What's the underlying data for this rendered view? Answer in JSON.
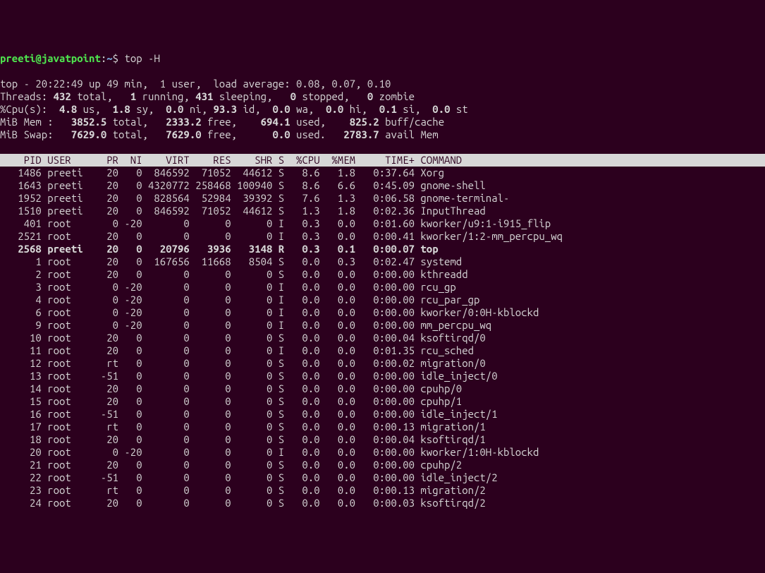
{
  "prompt": {
    "user": "preeti@javatpoint",
    "path": "~",
    "command": "top -H"
  },
  "summary": {
    "line1": "top - 20:22:49 up 49 min,  1 user,  load average: 0.08, 0.07, 0.10",
    "threads": {
      "total": "432",
      "running": "1",
      "sleeping": "431",
      "stopped": "0",
      "zombie": "0"
    },
    "cpu": {
      "us": "4.8",
      "sy": "1.8",
      "ni": "0.0",
      "id": "93.3",
      "wa": "0.0",
      "hi": "0.0",
      "si": "0.1",
      "st": "0.0"
    },
    "mem": {
      "total": "3852.5",
      "free": "2333.2",
      "used": "694.1",
      "buff": "825.2"
    },
    "swap": {
      "total": "7629.0",
      "free": "7629.0",
      "used": "0.0",
      "avail": "2783.7"
    }
  },
  "headers": "    PID USER      PR  NI    VIRT    RES    SHR S  %CPU  %MEM     TIME+ COMMAND",
  "processes": [
    {
      "pid": "1486",
      "user": "preeti",
      "pr": "20",
      "ni": "0",
      "virt": "846592",
      "res": "71052",
      "shr": "44612",
      "s": "S",
      "cpu": "8.6",
      "mem": "1.8",
      "time": "0:37.64",
      "cmd": "Xorg",
      "bold": false
    },
    {
      "pid": "1643",
      "user": "preeti",
      "pr": "20",
      "ni": "0",
      "virt": "4320772",
      "res": "258468",
      "shr": "100940",
      "s": "S",
      "cpu": "8.6",
      "mem": "6.6",
      "time": "0:45.09",
      "cmd": "gnome-shell",
      "bold": false
    },
    {
      "pid": "1952",
      "user": "preeti",
      "pr": "20",
      "ni": "0",
      "virt": "828564",
      "res": "52984",
      "shr": "39392",
      "s": "S",
      "cpu": "7.6",
      "mem": "1.3",
      "time": "0:06.58",
      "cmd": "gnome-terminal-",
      "bold": false
    },
    {
      "pid": "1510",
      "user": "preeti",
      "pr": "20",
      "ni": "0",
      "virt": "846592",
      "res": "71052",
      "shr": "44612",
      "s": "S",
      "cpu": "1.3",
      "mem": "1.8",
      "time": "0:02.36",
      "cmd": "InputThread",
      "bold": false
    },
    {
      "pid": "401",
      "user": "root",
      "pr": "0",
      "ni": "-20",
      "virt": "0",
      "res": "0",
      "shr": "0",
      "s": "I",
      "cpu": "0.3",
      "mem": "0.0",
      "time": "0:01.60",
      "cmd": "kworker/u9:1-i915_flip",
      "bold": false
    },
    {
      "pid": "2521",
      "user": "root",
      "pr": "20",
      "ni": "0",
      "virt": "0",
      "res": "0",
      "shr": "0",
      "s": "I",
      "cpu": "0.3",
      "mem": "0.0",
      "time": "0:00.41",
      "cmd": "kworker/1:2-mm_percpu_wq",
      "bold": false
    },
    {
      "pid": "2568",
      "user": "preeti",
      "pr": "20",
      "ni": "0",
      "virt": "20796",
      "res": "3936",
      "shr": "3148",
      "s": "R",
      "cpu": "0.3",
      "mem": "0.1",
      "time": "0:00.07",
      "cmd": "top",
      "bold": true
    },
    {
      "pid": "1",
      "user": "root",
      "pr": "20",
      "ni": "0",
      "virt": "167656",
      "res": "11668",
      "shr": "8504",
      "s": "S",
      "cpu": "0.0",
      "mem": "0.3",
      "time": "0:02.47",
      "cmd": "systemd",
      "bold": false
    },
    {
      "pid": "2",
      "user": "root",
      "pr": "20",
      "ni": "0",
      "virt": "0",
      "res": "0",
      "shr": "0",
      "s": "S",
      "cpu": "0.0",
      "mem": "0.0",
      "time": "0:00.00",
      "cmd": "kthreadd",
      "bold": false
    },
    {
      "pid": "3",
      "user": "root",
      "pr": "0",
      "ni": "-20",
      "virt": "0",
      "res": "0",
      "shr": "0",
      "s": "I",
      "cpu": "0.0",
      "mem": "0.0",
      "time": "0:00.00",
      "cmd": "rcu_gp",
      "bold": false
    },
    {
      "pid": "4",
      "user": "root",
      "pr": "0",
      "ni": "-20",
      "virt": "0",
      "res": "0",
      "shr": "0",
      "s": "I",
      "cpu": "0.0",
      "mem": "0.0",
      "time": "0:00.00",
      "cmd": "rcu_par_gp",
      "bold": false
    },
    {
      "pid": "6",
      "user": "root",
      "pr": "0",
      "ni": "-20",
      "virt": "0",
      "res": "0",
      "shr": "0",
      "s": "I",
      "cpu": "0.0",
      "mem": "0.0",
      "time": "0:00.00",
      "cmd": "kworker/0:0H-kblockd",
      "bold": false
    },
    {
      "pid": "9",
      "user": "root",
      "pr": "0",
      "ni": "-20",
      "virt": "0",
      "res": "0",
      "shr": "0",
      "s": "I",
      "cpu": "0.0",
      "mem": "0.0",
      "time": "0:00.00",
      "cmd": "mm_percpu_wq",
      "bold": false
    },
    {
      "pid": "10",
      "user": "root",
      "pr": "20",
      "ni": "0",
      "virt": "0",
      "res": "0",
      "shr": "0",
      "s": "S",
      "cpu": "0.0",
      "mem": "0.0",
      "time": "0:00.04",
      "cmd": "ksoftirqd/0",
      "bold": false
    },
    {
      "pid": "11",
      "user": "root",
      "pr": "20",
      "ni": "0",
      "virt": "0",
      "res": "0",
      "shr": "0",
      "s": "I",
      "cpu": "0.0",
      "mem": "0.0",
      "time": "0:01.35",
      "cmd": "rcu_sched",
      "bold": false
    },
    {
      "pid": "12",
      "user": "root",
      "pr": "rt",
      "ni": "0",
      "virt": "0",
      "res": "0",
      "shr": "0",
      "s": "S",
      "cpu": "0.0",
      "mem": "0.0",
      "time": "0:00.02",
      "cmd": "migration/0",
      "bold": false
    },
    {
      "pid": "13",
      "user": "root",
      "pr": "-51",
      "ni": "0",
      "virt": "0",
      "res": "0",
      "shr": "0",
      "s": "S",
      "cpu": "0.0",
      "mem": "0.0",
      "time": "0:00.00",
      "cmd": "idle_inject/0",
      "bold": false
    },
    {
      "pid": "14",
      "user": "root",
      "pr": "20",
      "ni": "0",
      "virt": "0",
      "res": "0",
      "shr": "0",
      "s": "S",
      "cpu": "0.0",
      "mem": "0.0",
      "time": "0:00.00",
      "cmd": "cpuhp/0",
      "bold": false
    },
    {
      "pid": "15",
      "user": "root",
      "pr": "20",
      "ni": "0",
      "virt": "0",
      "res": "0",
      "shr": "0",
      "s": "S",
      "cpu": "0.0",
      "mem": "0.0",
      "time": "0:00.00",
      "cmd": "cpuhp/1",
      "bold": false
    },
    {
      "pid": "16",
      "user": "root",
      "pr": "-51",
      "ni": "0",
      "virt": "0",
      "res": "0",
      "shr": "0",
      "s": "S",
      "cpu": "0.0",
      "mem": "0.0",
      "time": "0:00.00",
      "cmd": "idle_inject/1",
      "bold": false
    },
    {
      "pid": "17",
      "user": "root",
      "pr": "rt",
      "ni": "0",
      "virt": "0",
      "res": "0",
      "shr": "0",
      "s": "S",
      "cpu": "0.0",
      "mem": "0.0",
      "time": "0:00.13",
      "cmd": "migration/1",
      "bold": false
    },
    {
      "pid": "18",
      "user": "root",
      "pr": "20",
      "ni": "0",
      "virt": "0",
      "res": "0",
      "shr": "0",
      "s": "S",
      "cpu": "0.0",
      "mem": "0.0",
      "time": "0:00.04",
      "cmd": "ksoftirqd/1",
      "bold": false
    },
    {
      "pid": "20",
      "user": "root",
      "pr": "0",
      "ni": "-20",
      "virt": "0",
      "res": "0",
      "shr": "0",
      "s": "I",
      "cpu": "0.0",
      "mem": "0.0",
      "time": "0:00.00",
      "cmd": "kworker/1:0H-kblockd",
      "bold": false
    },
    {
      "pid": "21",
      "user": "root",
      "pr": "20",
      "ni": "0",
      "virt": "0",
      "res": "0",
      "shr": "0",
      "s": "S",
      "cpu": "0.0",
      "mem": "0.0",
      "time": "0:00.00",
      "cmd": "cpuhp/2",
      "bold": false
    },
    {
      "pid": "22",
      "user": "root",
      "pr": "-51",
      "ni": "0",
      "virt": "0",
      "res": "0",
      "shr": "0",
      "s": "S",
      "cpu": "0.0",
      "mem": "0.0",
      "time": "0:00.00",
      "cmd": "idle_inject/2",
      "bold": false
    },
    {
      "pid": "23",
      "user": "root",
      "pr": "rt",
      "ni": "0",
      "virt": "0",
      "res": "0",
      "shr": "0",
      "s": "S",
      "cpu": "0.0",
      "mem": "0.0",
      "time": "0:00.13",
      "cmd": "migration/2",
      "bold": false
    },
    {
      "pid": "24",
      "user": "root",
      "pr": "20",
      "ni": "0",
      "virt": "0",
      "res": "0",
      "shr": "0",
      "s": "S",
      "cpu": "0.0",
      "mem": "0.0",
      "time": "0:00.03",
      "cmd": "ksoftirqd/2",
      "bold": false
    }
  ]
}
